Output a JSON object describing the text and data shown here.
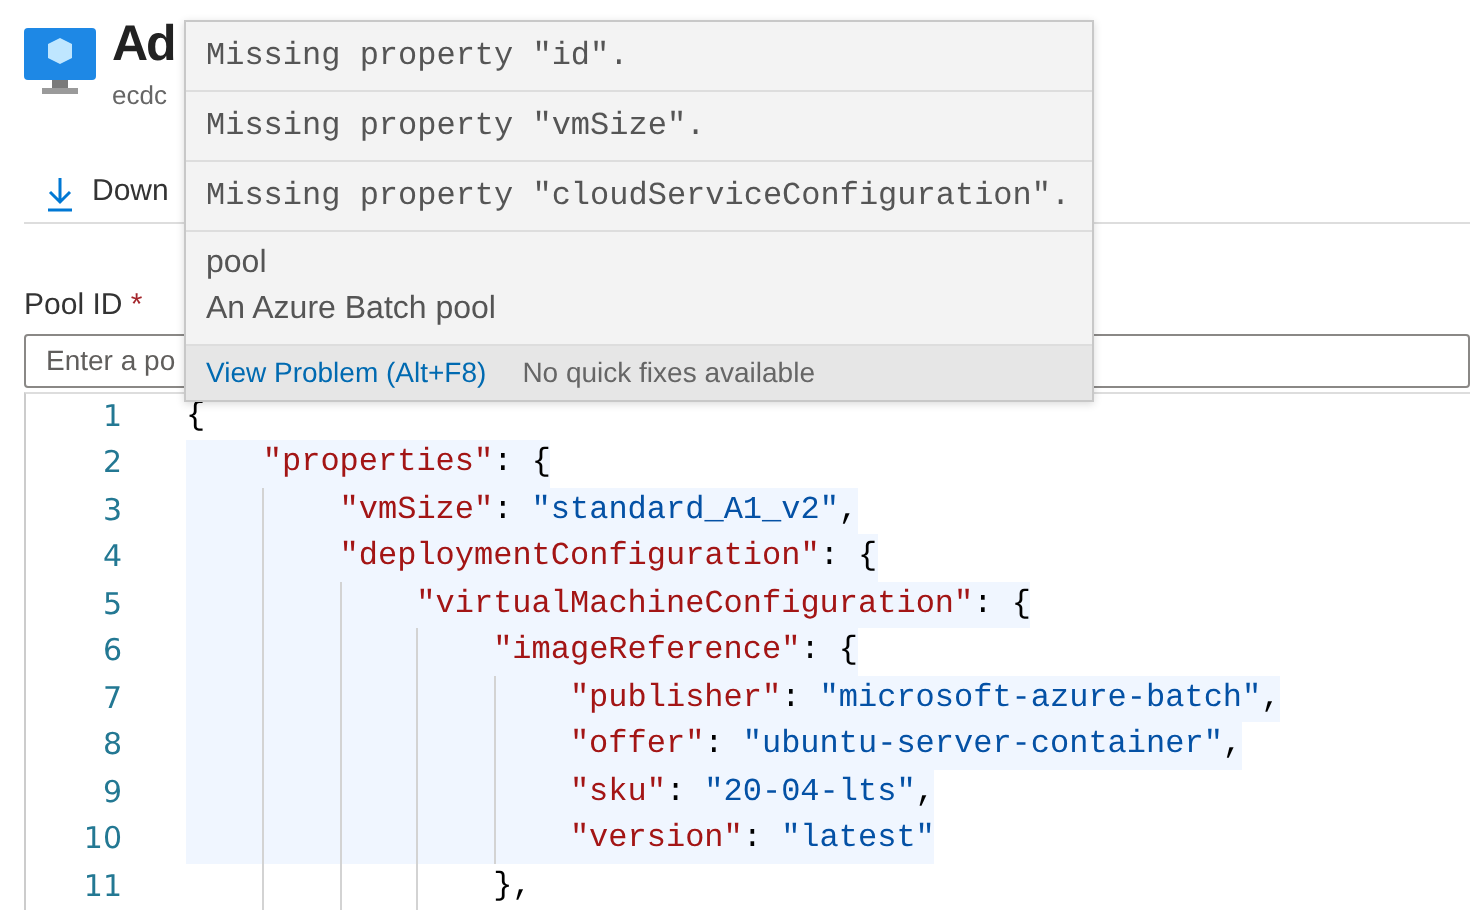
{
  "page": {
    "title": "Ad",
    "subtitle": "ecdc"
  },
  "toolbar": [
    {
      "label": "Down"
    }
  ],
  "form": {
    "label": "Pool ID",
    "required_mark": "*",
    "placeholder": "Enter a po"
  },
  "editor": {
    "lines": [
      {
        "number": "1",
        "highlighted": false,
        "tokens": [
          {
            "kind": "punct",
            "text": "{"
          }
        ]
      },
      {
        "number": "2",
        "highlighted": true,
        "tokens": [
          {
            "kind": "key",
            "text": "    \"properties\""
          },
          {
            "kind": "punct",
            "text": ": {"
          }
        ]
      },
      {
        "number": "3",
        "highlighted": true,
        "tokens": [
          {
            "kind": "key",
            "text": "        \"vmSize\""
          },
          {
            "kind": "punct",
            "text": ": "
          },
          {
            "kind": "string",
            "text": "\"standard_A1_v2\""
          },
          {
            "kind": "punct",
            "text": ","
          }
        ]
      },
      {
        "number": "4",
        "highlighted": true,
        "tokens": [
          {
            "kind": "key",
            "text": "        \"deploymentConfiguration\""
          },
          {
            "kind": "punct",
            "text": ": {"
          }
        ]
      },
      {
        "number": "5",
        "highlighted": true,
        "tokens": [
          {
            "kind": "key",
            "text": "            \"virtualMachineConfiguration\""
          },
          {
            "kind": "punct",
            "text": ": {"
          }
        ]
      },
      {
        "number": "6",
        "highlighted": true,
        "tokens": [
          {
            "kind": "key",
            "text": "                \"imageReference\""
          },
          {
            "kind": "punct",
            "text": ": {"
          }
        ]
      },
      {
        "number": "7",
        "highlighted": true,
        "tokens": [
          {
            "kind": "key",
            "text": "                    \"publisher\""
          },
          {
            "kind": "punct",
            "text": ": "
          },
          {
            "kind": "string",
            "text": "\"microsoft-azure-batch\""
          },
          {
            "kind": "punct",
            "text": ","
          }
        ]
      },
      {
        "number": "8",
        "highlighted": true,
        "tokens": [
          {
            "kind": "key",
            "text": "                    \"offer\""
          },
          {
            "kind": "punct",
            "text": ": "
          },
          {
            "kind": "string",
            "text": "\"ubuntu-server-container\""
          },
          {
            "kind": "punct",
            "text": ","
          }
        ]
      },
      {
        "number": "9",
        "highlighted": true,
        "tokens": [
          {
            "kind": "key",
            "text": "                    \"sku\""
          },
          {
            "kind": "punct",
            "text": ": "
          },
          {
            "kind": "string",
            "text": "\"20-04-lts\""
          },
          {
            "kind": "punct",
            "text": ","
          }
        ]
      },
      {
        "number": "10",
        "highlighted": true,
        "tokens": [
          {
            "kind": "key",
            "text": "                    \"version\""
          },
          {
            "kind": "punct",
            "text": ": "
          },
          {
            "kind": "string",
            "text": "\"latest\""
          }
        ]
      },
      {
        "number": "11",
        "highlighted": false,
        "tokens": [
          {
            "kind": "punct",
            "text": "                },"
          }
        ]
      }
    ]
  },
  "hover_popup": {
    "problems": [
      "Missing property \"id\".",
      "Missing property \"vmSize\".",
      "Missing property \"cloudServiceConfiguration\"."
    ],
    "info_title": "pool",
    "info_description": "An Azure Batch pool",
    "action": "View Problem (Alt+F8)",
    "status": "No quick fixes available"
  }
}
